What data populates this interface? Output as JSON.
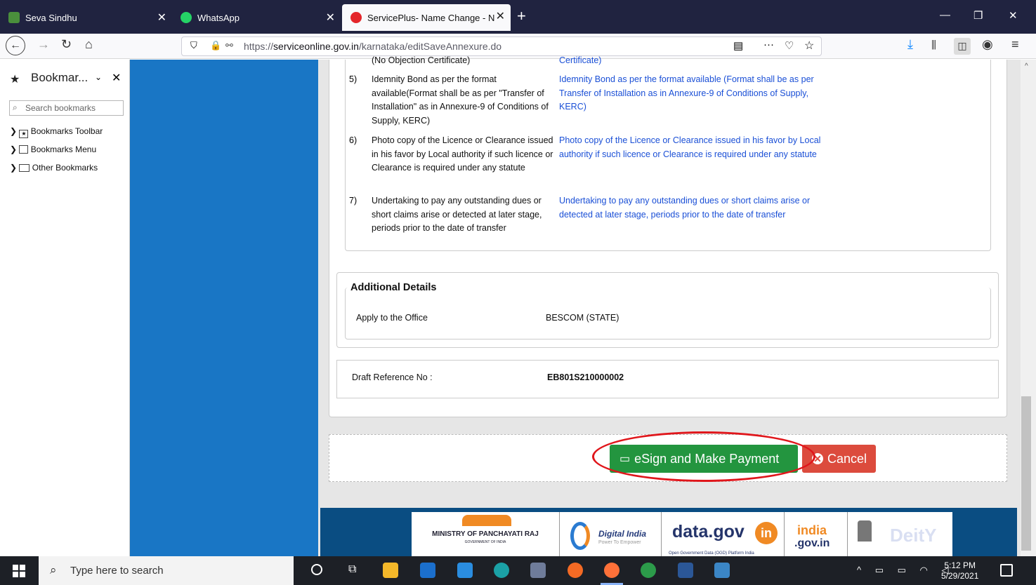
{
  "browser": {
    "tabs": [
      {
        "title": "Seva Sindhu"
      },
      {
        "title": "WhatsApp"
      },
      {
        "title": "ServicePlus- Name Change - N"
      }
    ],
    "url_prefix": "https://",
    "url_domain": "serviceonline.gov.in",
    "url_path": "/karnataka/editSaveAnnexure.do"
  },
  "sidebar": {
    "title": "Bookmar...",
    "search_placeholder": "Search bookmarks",
    "items": [
      {
        "label": "Bookmarks Toolbar"
      },
      {
        "label": "Bookmarks Menu"
      },
      {
        "label": "Other Bookmarks"
      }
    ]
  },
  "documents": {
    "top_left_cut": "(No Objection Certificate)",
    "top_right_cut": "Certificate)",
    "rows": [
      {
        "num": "5)",
        "left": "Idemnity Bond as per the format available(Format shall be as per \"Transfer of Installation\" as in Annexure-9 of Conditions of Supply, KERC)",
        "right": "Idemnity Bond as per the format available (Format shall be as per Transfer of Installation as in Annexure-9 of Conditions of Supply, KERC)"
      },
      {
        "num": "6)",
        "left": "Photo copy of the Licence or Clearance issued in his favor by Local authority if such licence or Clearance is required under any statute",
        "right": "Photo copy of the Licence or Clearance issued in his favor by Local authority if such licence or Clearance is required under any statute"
      },
      {
        "num": "7)",
        "left": "Undertaking to pay any outstanding dues or short claims arise or detected at later stage, periods prior to the date of transfer",
        "right": "Undertaking to pay any outstanding dues or short claims arise or detected at later stage, periods prior to the date of transfer"
      }
    ]
  },
  "additional": {
    "heading": "Additional Details",
    "label": "Apply to the Office",
    "value": "BESCOM (STATE)"
  },
  "draft": {
    "label": "Draft Reference No :",
    "value": "EB801S210000002"
  },
  "buttons": {
    "esign": "eSign and Make Payment",
    "cancel": "Cancel"
  },
  "footer": {
    "panchayat": "MINISTRY OF PANCHAYATI RAJ",
    "panchayat_sub": "GOVERNMENT OF INDIA",
    "digital": "Digital India",
    "digital_sub": "Power To Empower",
    "datagov": "data.gov",
    "datagov_sub": "Open Government Data (OGD) Platform India",
    "indiagov": "india",
    "indiagov2": ".gov.in",
    "deity": "DeitY"
  },
  "taskbar": {
    "search_placeholder": "Type here to search",
    "time": "5:12 PM",
    "date": "5/29/2021"
  }
}
